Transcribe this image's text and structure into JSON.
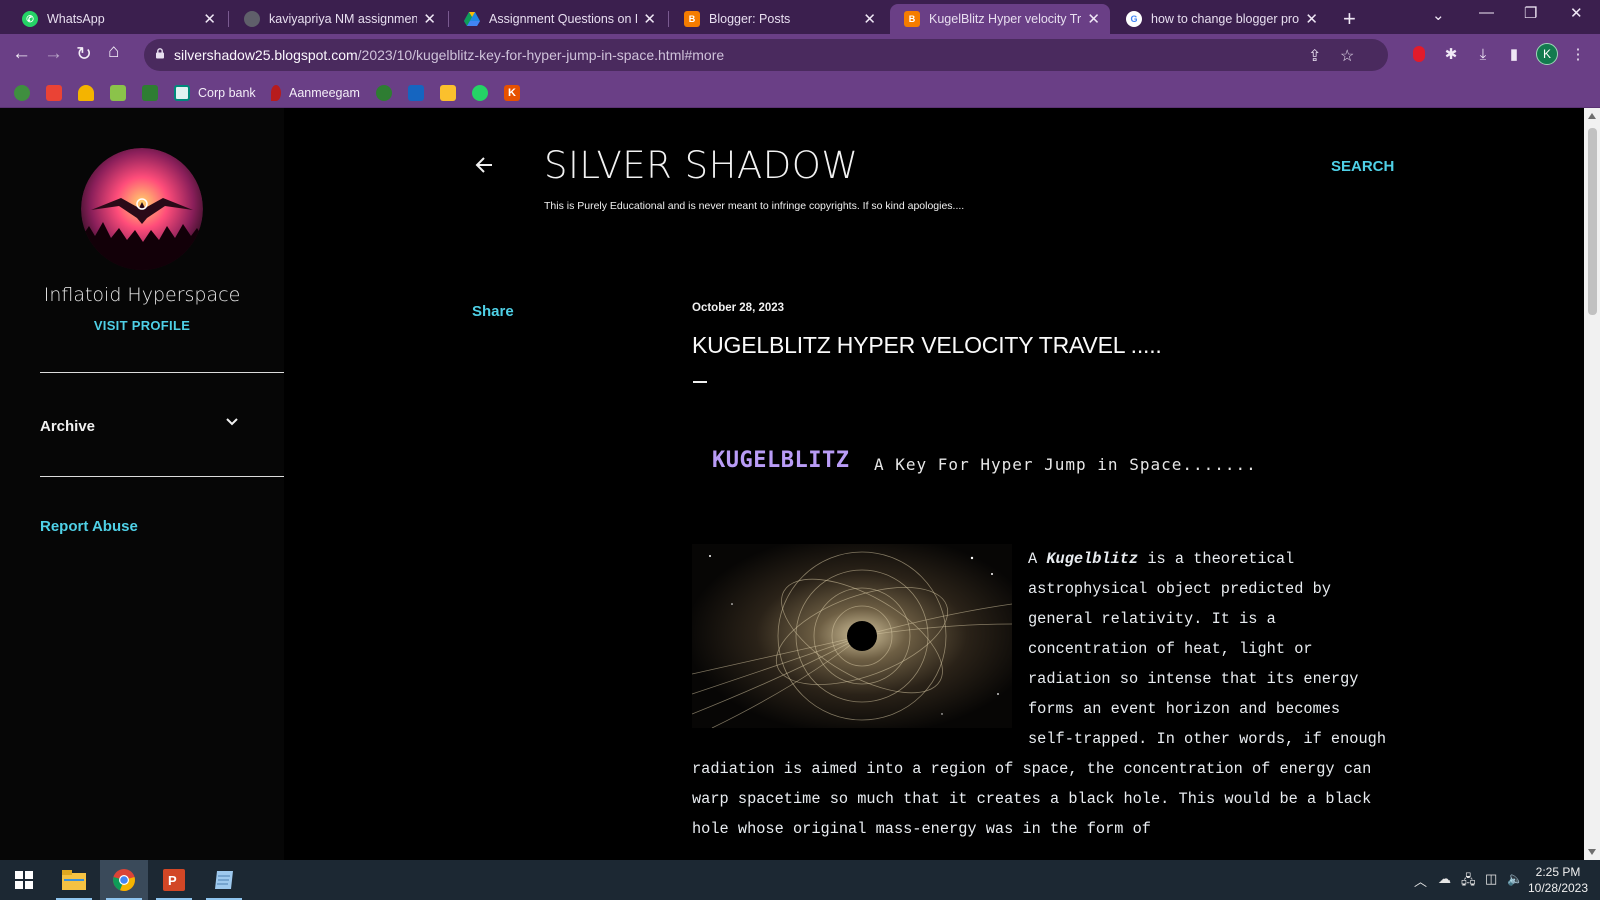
{
  "browser": {
    "tabs": [
      {
        "title": "WhatsApp",
        "icon": "whatsapp-icon",
        "active": false
      },
      {
        "title": "kaviyapriya NM assignment c",
        "icon": "globe-icon",
        "active": false
      },
      {
        "title": "Assignment Questions on Di",
        "icon": "google-drive-icon",
        "active": false
      },
      {
        "title": "Blogger: Posts",
        "icon": "blogger-icon",
        "active": false
      },
      {
        "title": "KugelBlitz Hyper velocity Tra",
        "icon": "blogger-icon",
        "active": true
      },
      {
        "title": "how to change blogger profi",
        "icon": "google-icon",
        "active": false
      }
    ],
    "url_host": "silvershadow25.blogspot.com",
    "url_path": "/2023/10/kugelblitz-key-for-hyper-jump-in-space.html#more",
    "profile_initial": "K",
    "bookmarks": [
      {
        "label": "",
        "icon": "bookmark-green-icon"
      },
      {
        "label": "",
        "icon": "gmail-icon"
      },
      {
        "label": "",
        "icon": "crown-icon"
      },
      {
        "label": "",
        "icon": "leaf-icon"
      },
      {
        "label": "",
        "icon": "dragon-icon"
      },
      {
        "label": "Corp bank",
        "icon": "corp-bank-icon"
      },
      {
        "label": "Aanmeegam",
        "icon": "aanmeegam-icon"
      },
      {
        "label": "",
        "icon": "moon-icon"
      },
      {
        "label": "",
        "icon": "flag-icon"
      },
      {
        "label": "",
        "icon": "image-icon"
      },
      {
        "label": "",
        "icon": "whatsapp-icon"
      },
      {
        "label": "",
        "icon": "k-icon"
      }
    ]
  },
  "sidebar": {
    "profile_name": "Inflatoid Hyperspace",
    "visit_profile": "VISIT PROFILE",
    "archive": "Archive",
    "report_abuse": "Report Abuse"
  },
  "header": {
    "title": "SILVER SHADOW",
    "description": "This is Purely Educational and is never meant to infringe copyrights. If so kind apologies....",
    "search": "SEARCH"
  },
  "post": {
    "share": "Share",
    "date": "October 28, 2023",
    "title": "KUGELBLITZ HYPER VELOCITY TRAVEL .....",
    "heading_word": "KUGELBLITZ",
    "heading_sub": "A Key For Hyper Jump in Space.......",
    "body_prefix": "A ",
    "body_em": "Kugelblitz",
    "body_rest": " is a theoretical astrophysical object predicted by general relativity. It is a concentration of heat, light or radiation so intense that its energy forms an event horizon and becomes self-trapped. In other words, if enough radiation is aimed into a region of space, the concentration of energy can warp spacetime so much that it creates a black hole. This would be a black hole whose original mass-energy was in the form of"
  },
  "taskbar": {
    "time": "2:25 PM",
    "date": "10/28/2023"
  },
  "colors": {
    "tabstrip": "#3b1f4e",
    "toolbar": "#6a3f86",
    "accent_link": "#4fd0e6",
    "heading_purple": "#b99cf6"
  }
}
